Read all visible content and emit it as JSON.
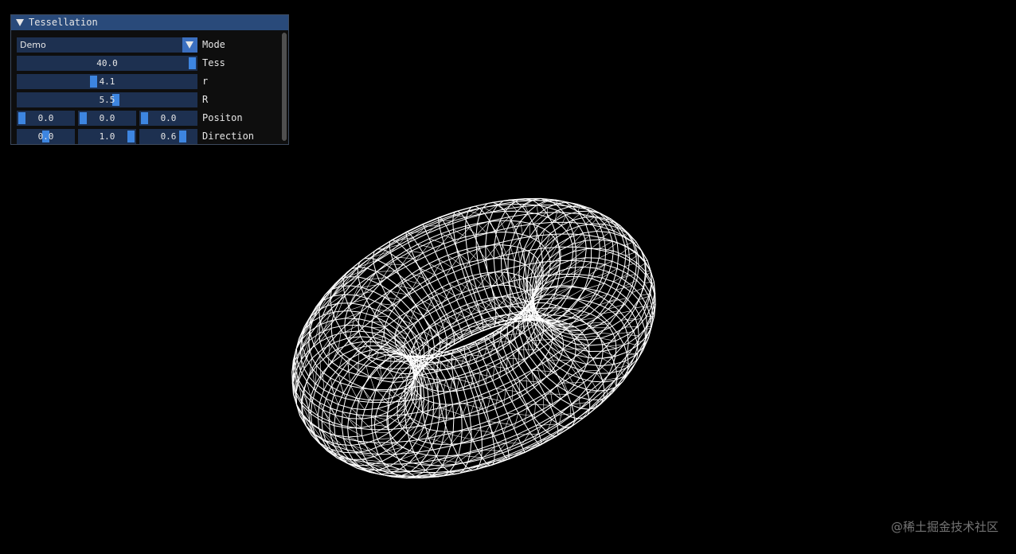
{
  "panel": {
    "title": "Tessellation",
    "mode": {
      "label": "Mode",
      "value": "Demo"
    },
    "tess": {
      "label": "Tess",
      "value": "40.0",
      "fraction": 1.0
    },
    "r": {
      "label": "r",
      "value": "4.1",
      "fraction": 0.42
    },
    "R": {
      "label": "R",
      "value": "5.5",
      "fraction": 0.55
    },
    "position": {
      "label": "Positon",
      "values": [
        "0.0",
        "0.0",
        "0.0"
      ],
      "fractions": [
        0.0,
        0.0,
        0.0
      ]
    },
    "direction": {
      "label": "Direction",
      "values": [
        "0.0",
        "1.0",
        "0.6"
      ],
      "fractions": [
        0.5,
        1.0,
        0.8
      ]
    }
  },
  "viewport": {
    "shape": "torus-wireframe",
    "wire_color": "#ffffff",
    "background": "#000000"
  },
  "colors": {
    "title_bar": "#294a7a",
    "frame_bg": "#1d3050",
    "slider_grab": "#3d85e0",
    "text": "#e6e6e6"
  },
  "watermark": "@稀土掘金技术社区"
}
